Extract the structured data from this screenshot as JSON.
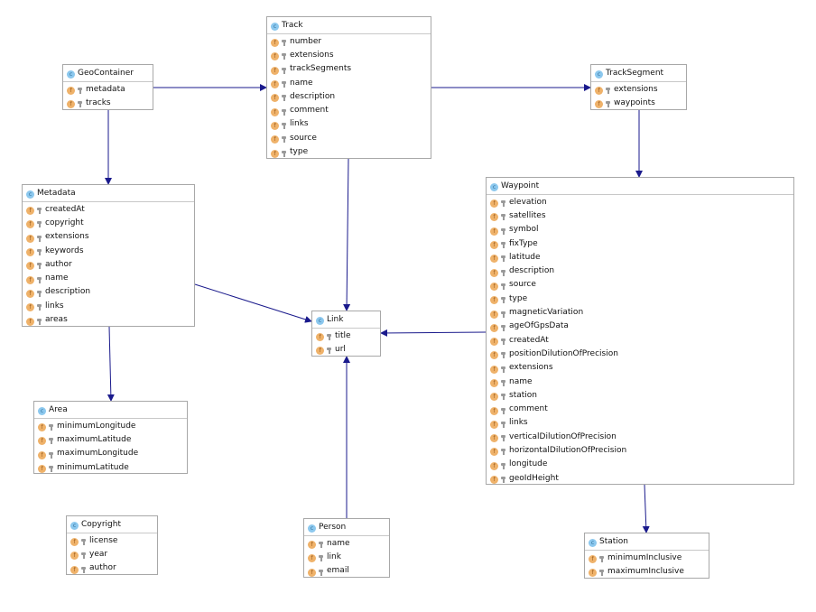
{
  "classes": [
    {
      "id": "GeoContainer",
      "name": "GeoContainer",
      "fields": [
        "metadata",
        "tracks"
      ]
    },
    {
      "id": "Track",
      "name": "Track",
      "fields": [
        "number",
        "extensions",
        "trackSegments",
        "name",
        "description",
        "comment",
        "links",
        "source",
        "type"
      ]
    },
    {
      "id": "TrackSegment",
      "name": "TrackSegment",
      "fields": [
        "extensions",
        "waypoints"
      ]
    },
    {
      "id": "Metadata",
      "name": "Metadata",
      "fields": [
        "createdAt",
        "copyright",
        "extensions",
        "keywords",
        "author",
        "name",
        "description",
        "links",
        "areas"
      ]
    },
    {
      "id": "Waypoint",
      "name": "Waypoint",
      "fields": [
        "elevation",
        "satellites",
        "symbol",
        "fixType",
        "latitude",
        "description",
        "source",
        "type",
        "magneticVariation",
        "ageOfGpsData",
        "createdAt",
        "positionDilutionOfPrecision",
        "extensions",
        "name",
        "station",
        "comment",
        "links",
        "verticalDilutionOfPrecision",
        "horizontalDilutionOfPrecision",
        "longitude",
        "geoIdHeight"
      ]
    },
    {
      "id": "Link",
      "name": "Link",
      "fields": [
        "title",
        "url"
      ]
    },
    {
      "id": "Area",
      "name": "Area",
      "fields": [
        "minimumLongitude",
        "maximumLatitude",
        "maximumLongitude",
        "minimumLatitude"
      ]
    },
    {
      "id": "Copyright",
      "name": "Copyright",
      "fields": [
        "license",
        "year",
        "author"
      ]
    },
    {
      "id": "Person",
      "name": "Person",
      "fields": [
        "name",
        "link",
        "email"
      ]
    },
    {
      "id": "Station",
      "name": "Station",
      "fields": [
        "minimumInclusive",
        "maximumInclusive"
      ]
    }
  ],
  "relations": [
    {
      "from": "GeoContainer",
      "to": "Track"
    },
    {
      "from": "GeoContainer",
      "to": "Metadata"
    },
    {
      "from": "Track",
      "to": "TrackSegment"
    },
    {
      "from": "TrackSegment",
      "to": "Waypoint"
    },
    {
      "from": "Track",
      "to": "Link"
    },
    {
      "from": "Metadata",
      "to": "Link"
    },
    {
      "from": "Waypoint",
      "to": "Link"
    },
    {
      "from": "Metadata",
      "to": "Area"
    },
    {
      "from": "Person",
      "to": "Link"
    },
    {
      "from": "Waypoint",
      "to": "Station"
    }
  ],
  "icons": {
    "class": "class-icon",
    "field": "field-icon",
    "visibility": "key-icon"
  },
  "colors": {
    "edge": "#1a1a8c",
    "class_icon": "#8cc8ee",
    "field_icon": "#efb26a",
    "border": "#a8a8a8"
  }
}
